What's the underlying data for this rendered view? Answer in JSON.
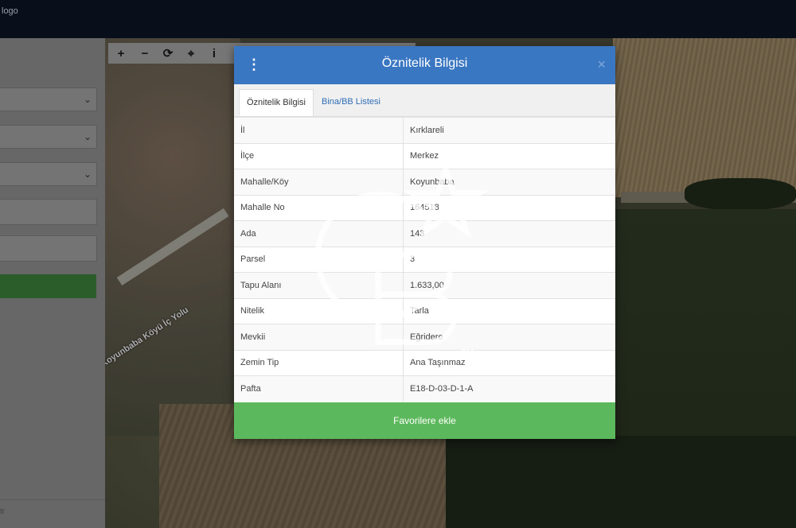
{
  "topbar": {
    "brand_fragment": "logo"
  },
  "map": {
    "road_label": "Koyunbaba Köyü İç Yolu"
  },
  "toolbar": {
    "zoom_in": "+",
    "zoom_out": "−",
    "refresh": "⟳",
    "locate": "⌖",
    "info": "i"
  },
  "sidepanel": {
    "footer_fragment": "tr"
  },
  "modal": {
    "title": "Öznitelik Bilgisi",
    "close": "×",
    "tabs": [
      {
        "label": "Öznitelik Bilgisi",
        "active": true
      },
      {
        "label": "Bina/BB Listesi",
        "active": false
      }
    ],
    "rows": [
      {
        "key": "İl",
        "value": "Kırklareli"
      },
      {
        "key": "İlçe",
        "value": "Merkez"
      },
      {
        "key": "Mahalle/Köy",
        "value": "Koyunbaba"
      },
      {
        "key": "Mahalle No",
        "value": "164518"
      },
      {
        "key": "Ada",
        "value": "143"
      },
      {
        "key": "Parsel",
        "value": "3"
      },
      {
        "key": "Tapu Alanı",
        "value": "1.633,00"
      },
      {
        "key": "Nitelik",
        "value": "Tarla"
      },
      {
        "key": "Mevkii",
        "value": "Eğridere"
      },
      {
        "key": "Zemin Tip",
        "value": "Ana Taşınmaz"
      },
      {
        "key": "Pafta",
        "value": "E18-D-03-D-1-A"
      }
    ],
    "favorite_button": "Favorilere ekle"
  },
  "watermark": {
    "mark": "SM"
  },
  "colors": {
    "header_blue": "#3a77c2",
    "favorite_green": "#5cb85c",
    "topbar_navy": "#0b1424"
  }
}
